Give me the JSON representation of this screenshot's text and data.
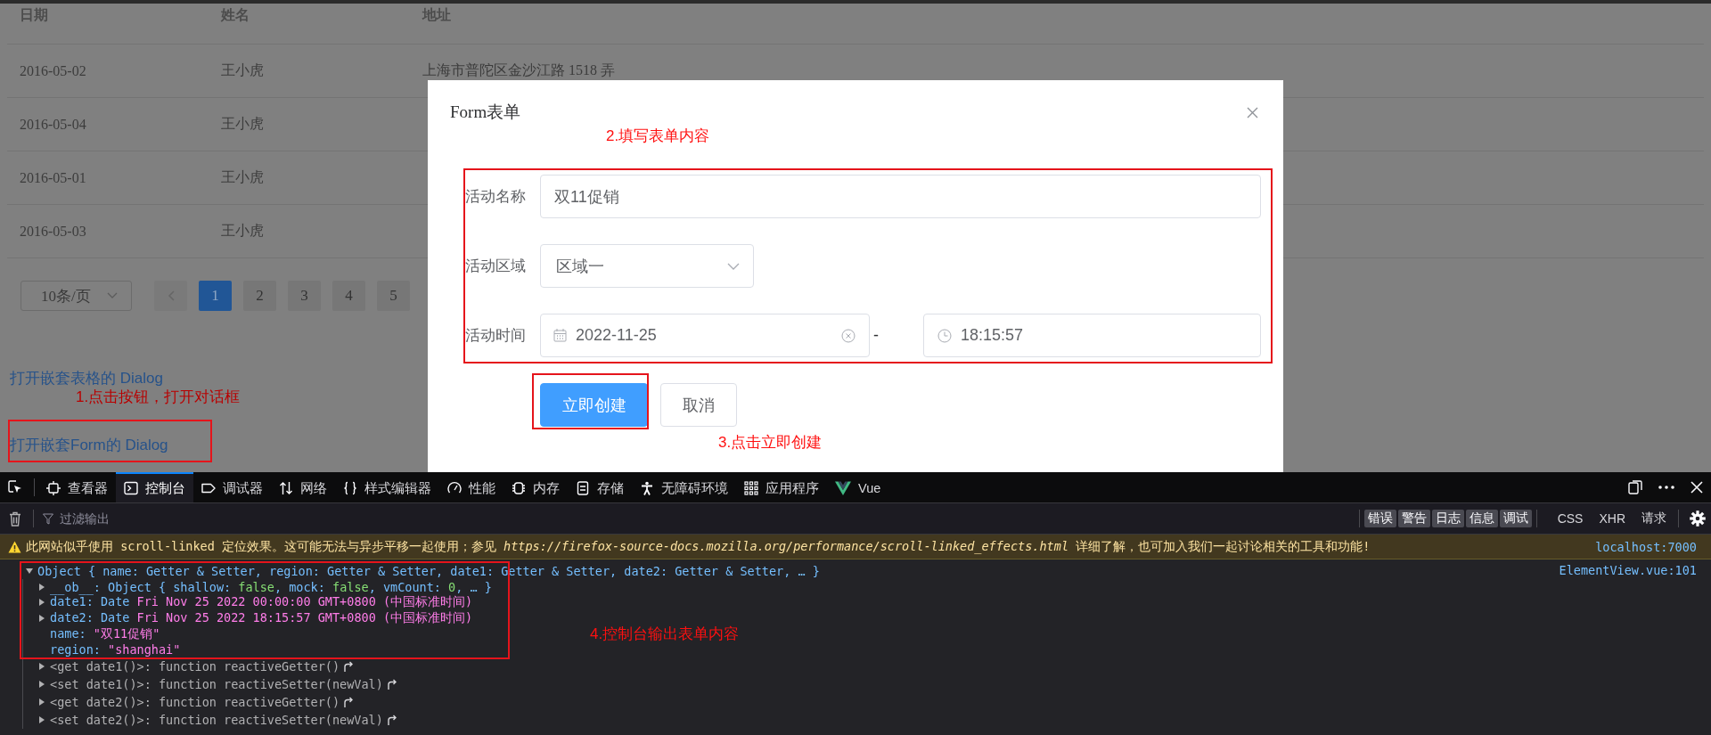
{
  "page": {
    "table": {
      "columns": [
        "日期",
        "姓名",
        "地址"
      ],
      "rows": [
        [
          "2016-05-02",
          "王小虎",
          "上海市普陀区金沙江路 1518 弄"
        ],
        [
          "2016-05-04",
          "王小虎"
        ],
        [
          "2016-05-01",
          "王小虎"
        ],
        [
          "2016-05-03",
          "王小虎"
        ]
      ]
    },
    "pagination": {
      "page_size": "10条/页",
      "pages": [
        {
          "label": "1",
          "selected": true
        },
        {
          "label": "2",
          "selected": false
        },
        {
          "label": "3",
          "selected": false
        },
        {
          "label": "4",
          "selected": false
        },
        {
          "label": "5",
          "selected": false
        }
      ]
    },
    "links": [
      "打开嵌套表格的 Dialog",
      "打开嵌套Form的 Dialog"
    ]
  },
  "dialog": {
    "title": "Form表单",
    "fields": [
      {
        "kind": "text",
        "label": "活动名称",
        "value": "双11促销"
      },
      {
        "kind": "select",
        "label": "活动区域",
        "value": "区域一"
      },
      {
        "kind": "datetime",
        "label": "活动时间",
        "date": "2022-11-25",
        "separator": "-",
        "time": "18:15:57"
      }
    ],
    "buttons": [
      {
        "label": "立即创建",
        "kind": "primary"
      },
      {
        "label": "取消",
        "kind": "default"
      }
    ]
  },
  "annotations": [
    {
      "text": "1.点击按钮，打开对话框"
    },
    {
      "text": "2.填写表单内容"
    },
    {
      "text": "3.点击立即创建"
    },
    {
      "text": "4.控制台输出表单内容"
    }
  ],
  "devtools": {
    "tabs": [
      {
        "label": "查看器",
        "selected": false
      },
      {
        "label": "控制台",
        "selected": true
      },
      {
        "label": "调试器",
        "selected": false
      },
      {
        "label": "网络",
        "selected": false
      },
      {
        "label": "样式编辑器",
        "selected": false
      },
      {
        "label": "性能",
        "selected": false
      },
      {
        "label": "内存",
        "selected": false
      },
      {
        "label": "存储",
        "selected": false
      },
      {
        "label": "无障碍环境",
        "selected": false
      },
      {
        "label": "应用程序",
        "selected": false
      },
      {
        "label": "Vue",
        "selected": false
      }
    ],
    "filter": {
      "placeholder": "过滤输出"
    },
    "levels": [
      {
        "label": "错误",
        "on": true
      },
      {
        "label": "警告",
        "on": true
      },
      {
        "label": "日志",
        "on": true
      },
      {
        "label": "信息",
        "on": true
      },
      {
        "label": "调试",
        "on": true
      }
    ],
    "requests": [
      {
        "label": "CSS",
        "on": false
      },
      {
        "label": "XHR",
        "on": false
      },
      {
        "label": "请求",
        "on": false
      }
    ],
    "messages": [
      {
        "kind": "warning",
        "text": "此网站似乎使用 scroll-linked 定位效果。这可能无法与异步平移一起使用；参见 *https://firefox-source-docs.mozilla.org/performance/scroll-linked_effects.html* 详细了解，也可加入我们一起讨论相关的工具和功能!",
        "source": "localhost:7000"
      },
      {
        "kind": "log",
        "source": "ElementView.vue:101",
        "tree": {
          "expanded": true,
          "parts": [
            {
              "text": "Object { name: Getter & Setter, region: Getter & Setter, date1: Getter & Setter, date2: Getter & Setter, … }",
              "kind": "plain"
            }
          ],
          "children": [
            {
              "expanded": false,
              "parts": [
                {
                  "text": "__ob__: Object { shallow: ",
                  "kind": "plain"
                },
                {
                  "text": "false",
                  "kind": "literal"
                },
                {
                  "text": ", mock: ",
                  "kind": "plain"
                },
                {
                  "text": "false",
                  "kind": "literal"
                },
                {
                  "text": ", vmCount: ",
                  "kind": "plain"
                },
                {
                  "text": "0",
                  "kind": "literal"
                },
                {
                  "text": ", … }",
                  "kind": "plain"
                }
              ]
            },
            {
              "expanded": false,
              "parts": [
                {
                  "text": "date1: Date ",
                  "kind": "plain"
                },
                {
                  "text": "Fri Nov 25 2022 00:00:00 GMT+0800 (中国标准时间)",
                  "kind": "string"
                }
              ]
            },
            {
              "expanded": false,
              "parts": [
                {
                  "text": "date2: Date ",
                  "kind": "plain"
                },
                {
                  "text": "Fri Nov 25 2022 18:15:57 GMT+0800 (中国标准时间)",
                  "kind": "string"
                }
              ]
            },
            {
              "parts": [
                {
                  "text": "name: ",
                  "kind": "plain"
                },
                {
                  "text": "\"双11促销\"",
                  "kind": "string"
                }
              ]
            },
            {
              "parts": [
                {
                  "text": "region: ",
                  "kind": "plain"
                },
                {
                  "text": "\"shanghai\"",
                  "kind": "string"
                }
              ]
            },
            {
              "expanded": false,
              "jump": true,
              "parts": [
                {
                  "text": "<get date1()>: function reactiveGetter()",
                  "kind": "muted"
                }
              ]
            },
            {
              "expanded": false,
              "jump": true,
              "parts": [
                {
                  "text": "<set date1()>: function reactiveSetter(newVal)",
                  "kind": "muted"
                }
              ]
            },
            {
              "expanded": false,
              "jump": true,
              "parts": [
                {
                  "text": "<get date2()>: function reactiveGetter()",
                  "kind": "muted"
                }
              ]
            },
            {
              "expanded": false,
              "jump": true,
              "parts": [
                {
                  "text": "<set date2()>: function reactiveSetter(newVal)",
                  "kind": "muted"
                }
              ]
            }
          ]
        }
      }
    ]
  }
}
